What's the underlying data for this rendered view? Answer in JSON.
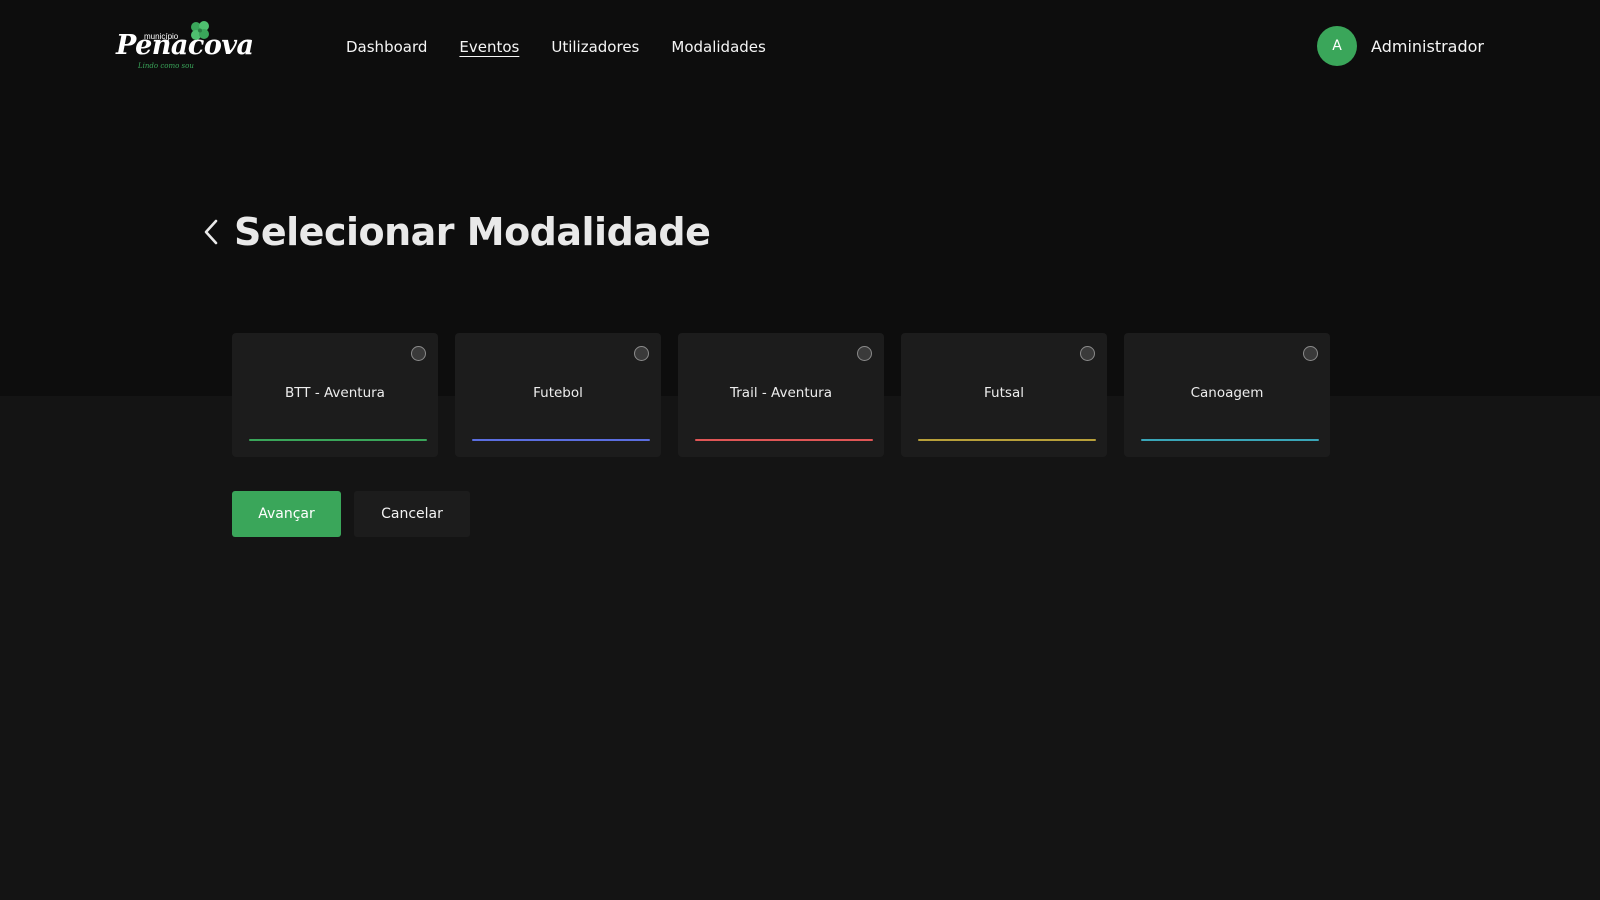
{
  "header": {
    "logo": {
      "small_text": "município",
      "main_text": "Penacova",
      "tagline": "Lindo como sou"
    },
    "nav": [
      {
        "label": "Dashboard",
        "active": false
      },
      {
        "label": "Eventos",
        "active": true
      },
      {
        "label": "Utilizadores",
        "active": false
      },
      {
        "label": "Modalidades",
        "active": false
      }
    ],
    "user": {
      "initial": "A",
      "name": "Administrador"
    }
  },
  "main": {
    "title": "Selecionar Modalidade",
    "modalities": [
      {
        "label": "BTT - Aventura",
        "color": "#3aa65a",
        "selected": false
      },
      {
        "label": "Futebol",
        "color": "#5b6ee0",
        "selected": false
      },
      {
        "label": "Trail - Aventura",
        "color": "#e05656",
        "selected": false
      },
      {
        "label": "Futsal",
        "color": "#b8a03a",
        "selected": false
      },
      {
        "label": "Canoagem",
        "color": "#3aa6b8",
        "selected": false
      }
    ],
    "actions": {
      "next_label": "Avançar",
      "cancel_label": "Cancelar"
    }
  },
  "colors": {
    "accent": "#3aa65a",
    "background": "#141414",
    "header_background": "#0d0d0d",
    "card_background": "#1c1c1c"
  },
  "icons": {
    "back": "chevron-left-icon",
    "logo_leaf": "four-leaf-clover-icon"
  }
}
